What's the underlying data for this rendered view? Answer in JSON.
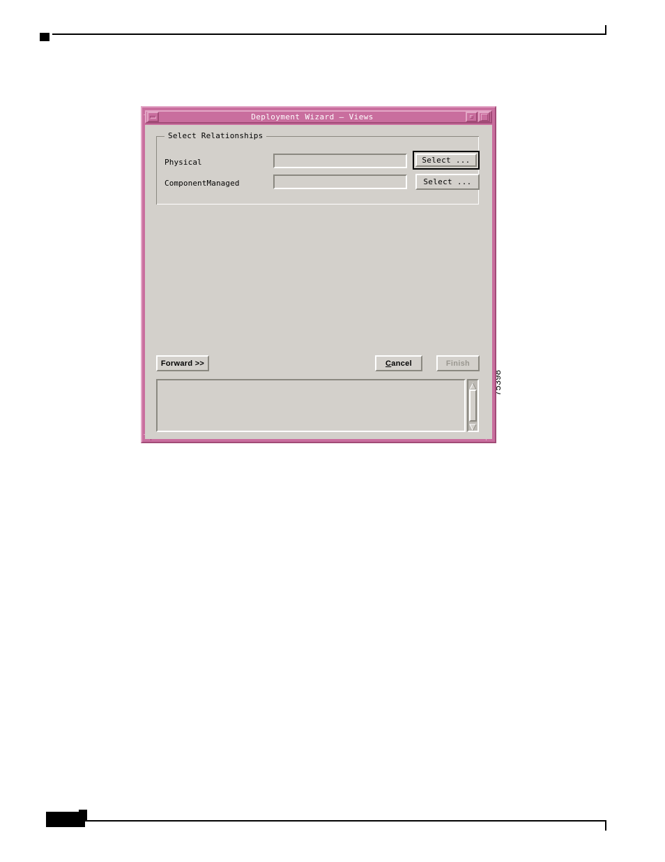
{
  "figure": {
    "id_label": "75398"
  },
  "window": {
    "title": "Deployment Wizard — Views",
    "titlebar_color": "#c96e9e",
    "frame_highlight": "#e3a7c6",
    "frame_shadow": "#a14b77",
    "client_color": "#d3d0cb",
    "controls": {
      "menu_icon": "window-menu-icon",
      "minimize_icon": "minimize-icon",
      "maximize_icon": "maximize-icon"
    }
  },
  "group": {
    "legend": "Select Relationships",
    "rows": [
      {
        "label": "Physical",
        "value": "",
        "button_label": "Select ...",
        "is_default": true
      },
      {
        "label": "ComponentManaged",
        "value": "",
        "button_label": "Select ...",
        "is_default": false
      }
    ]
  },
  "actions": {
    "forward": "Forward >>",
    "cancel_prefix": "C",
    "cancel_rest": "ancel",
    "finish": "Finish",
    "finish_enabled": false
  },
  "message_area": {
    "value": "",
    "scrollbar": {
      "up_arrow_icon": "triangle-up-icon",
      "down_arrow_icon": "triangle-down-icon",
      "thumb": "scroll-thumb"
    }
  }
}
